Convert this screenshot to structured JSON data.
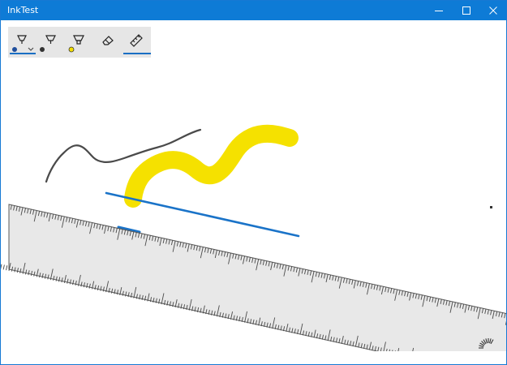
{
  "window": {
    "title": "InkTest",
    "accent_color": "#0e7bd6",
    "caption_buttons": [
      "minimize-icon",
      "maximize-icon",
      "close-icon"
    ]
  },
  "ink_toolbar": {
    "background": "#e6e6e6",
    "selected_tool": "ruler",
    "tools": [
      {
        "name": "ballpoint-pen",
        "icon": "ballpoint-pen-icon",
        "color": "#1f4e9c",
        "has_dropdown": true
      },
      {
        "name": "pencil",
        "icon": "pencil-icon",
        "color": "#333333"
      },
      {
        "name": "highlighter",
        "icon": "highlighter-icon",
        "color": "#f5e000"
      },
      {
        "name": "eraser",
        "icon": "eraser-icon"
      },
      {
        "name": "ruler",
        "icon": "ruler-icon",
        "active": true
      }
    ]
  },
  "ink_strokes": [
    {
      "tool": "pencil",
      "color": "#4a4a4a"
    },
    {
      "tool": "highlighter",
      "color": "#f5e100"
    },
    {
      "tool": "ballpoint-pen",
      "color": "#1a73c8"
    }
  ],
  "ruler": {
    "visible": true,
    "fill": "#e8e8e8",
    "protractor_handle_icon": "protractor-handle-icon"
  }
}
